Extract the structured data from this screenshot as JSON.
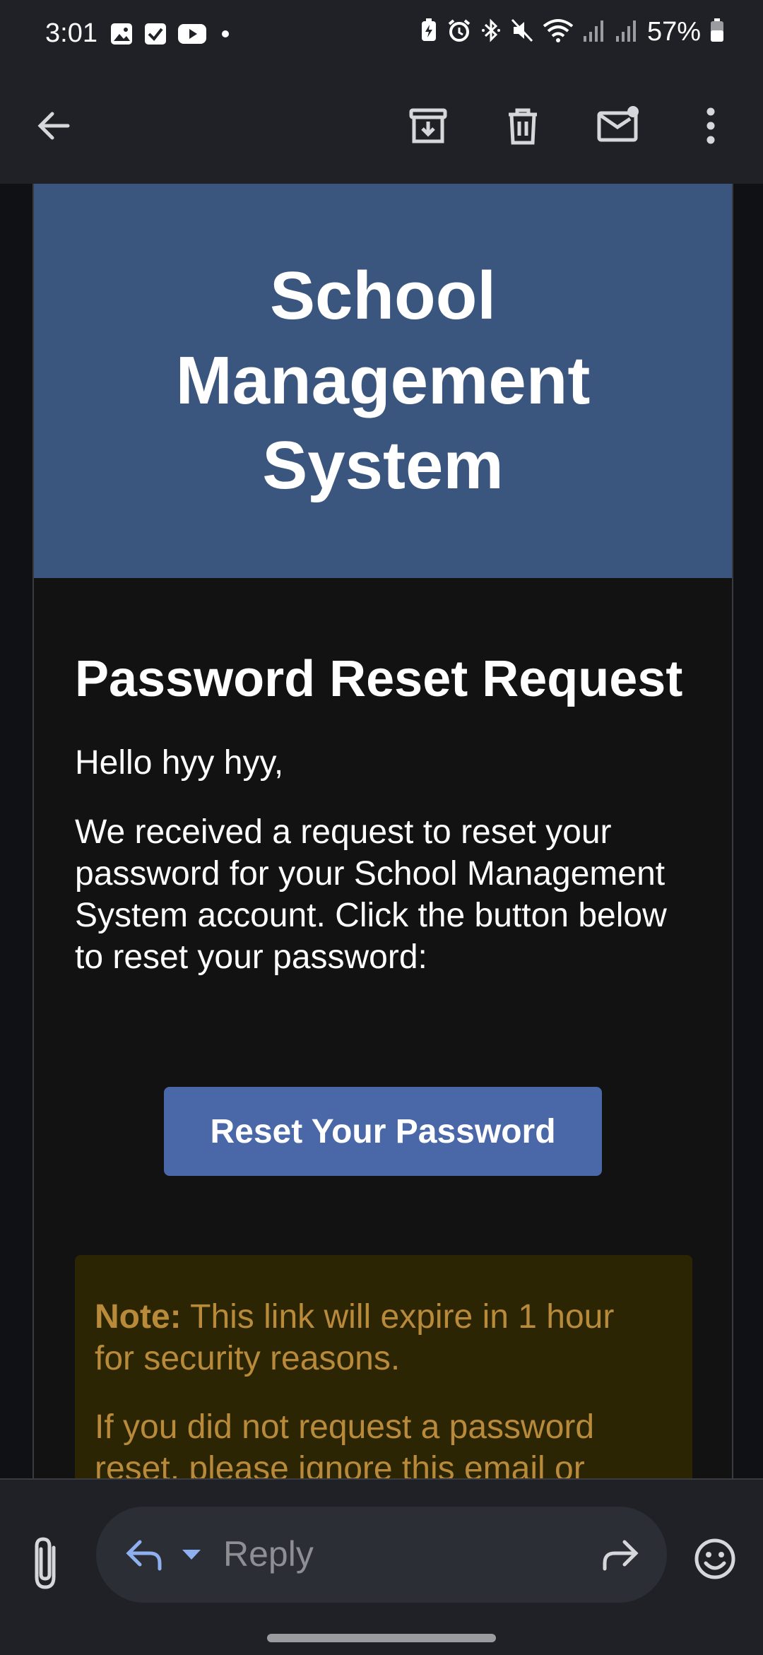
{
  "status_bar": {
    "time": "3:01",
    "battery_percent": "57%",
    "left_icons": [
      "gallery-icon",
      "checkbox-icon",
      "youtube-icon",
      "dot-icon"
    ],
    "right_icons": [
      "battery-saver-icon",
      "alarm-icon",
      "bluetooth-icon",
      "mute-icon",
      "wifi-icon",
      "signal-icon",
      "signal-icon",
      "battery-icon"
    ]
  },
  "toolbar": {
    "icons": [
      "back-arrow-icon",
      "archive-icon",
      "delete-icon",
      "mark-unread-icon",
      "more-options-icon"
    ]
  },
  "email": {
    "header_title": "School Management System",
    "reset_title": "Password Reset Request",
    "greeting": "Hello hyy hyy,",
    "body": "We received a request to reset your password for your School Management System account. Click the button below to reset your password:",
    "button_label": "Reset Your Password",
    "note_label": "Note:",
    "note_text": " This link will expire in 1 hour for security reasons.",
    "note_second": "If you did not request a password reset, please ignore this email or"
  },
  "reply_bar": {
    "placeholder": "Reply",
    "icons": [
      "attachment-icon",
      "reply-icon",
      "dropdown-icon",
      "forward-icon",
      "emoji-icon"
    ]
  },
  "colors": {
    "header_bg": "#3b567e",
    "button_bg": "#4a67a8",
    "note_bg": "#2b2504",
    "note_text": "#b88a3a"
  }
}
